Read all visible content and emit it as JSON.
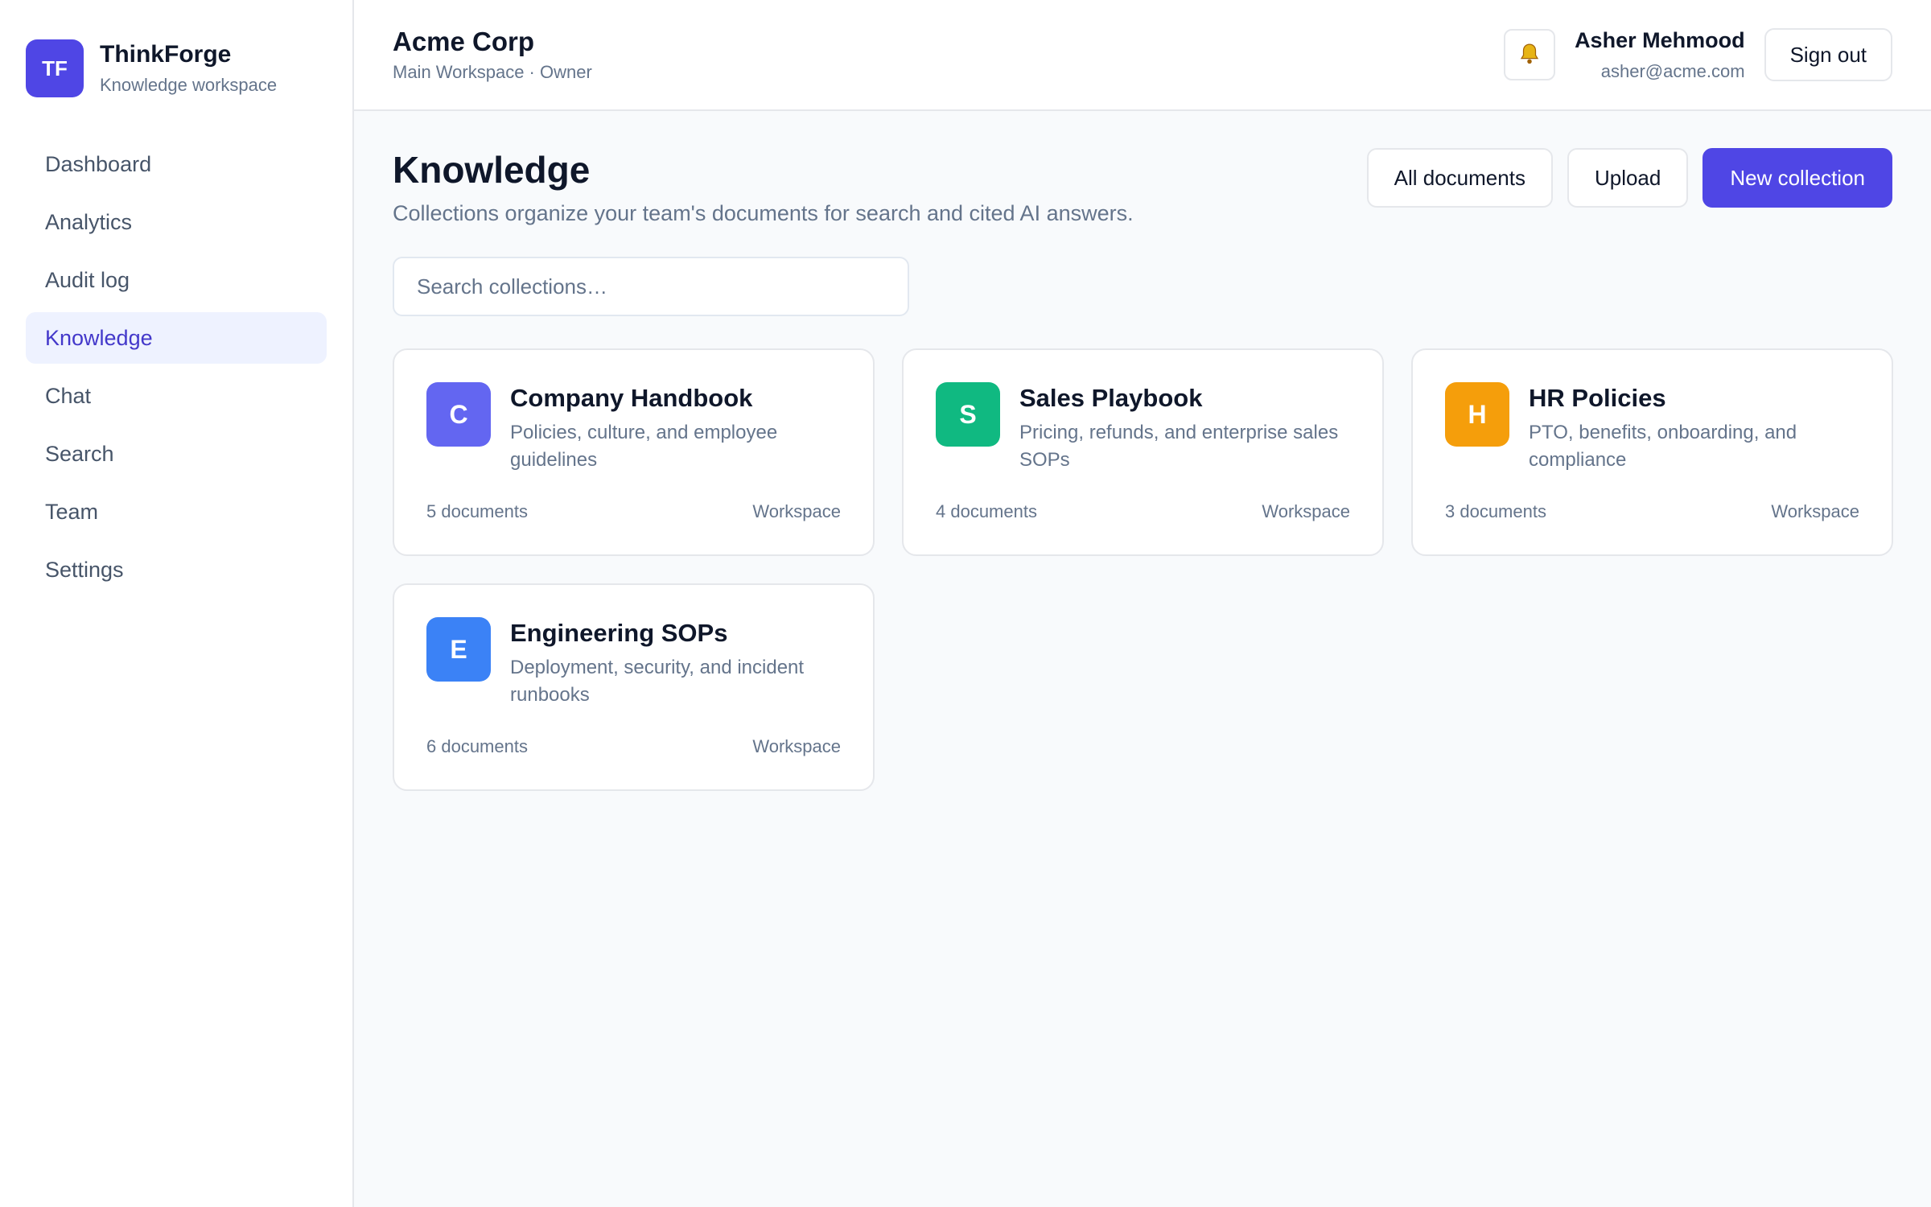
{
  "brand": {
    "initials": "TF",
    "name": "ThinkForge",
    "subtitle": "Knowledge workspace",
    "color": "#4f46e5"
  },
  "sidebar": {
    "items": [
      {
        "label": "Dashboard",
        "active": false
      },
      {
        "label": "Analytics",
        "active": false
      },
      {
        "label": "Audit log",
        "active": false
      },
      {
        "label": "Knowledge",
        "active": true
      },
      {
        "label": "Chat",
        "active": false
      },
      {
        "label": "Search",
        "active": false
      },
      {
        "label": "Team",
        "active": false
      },
      {
        "label": "Settings",
        "active": false
      }
    ]
  },
  "header": {
    "org_name": "Acme Corp",
    "org_sub": "Main Workspace · Owner",
    "bell_icon": "bell-icon",
    "user_name": "Asher Mehmood",
    "user_email": "asher@acme.com",
    "signout_label": "Sign out"
  },
  "page": {
    "title": "Knowledge",
    "subtitle": "Collections organize your team's documents for search and cited AI answers.",
    "actions": {
      "all_documents": "All documents",
      "upload": "Upload",
      "new_collection": "New collection"
    },
    "search_placeholder": "Search collections…"
  },
  "collections": [
    {
      "initial": "C",
      "color": "#6366f1",
      "title": "Company Handbook",
      "description": "Policies, culture, and employee guidelines",
      "count": "5 documents",
      "scope": "Workspace"
    },
    {
      "initial": "S",
      "color": "#10b981",
      "title": "Sales Playbook",
      "description": "Pricing, refunds, and enterprise sales SOPs",
      "count": "4 documents",
      "scope": "Workspace"
    },
    {
      "initial": "H",
      "color": "#f59e0b",
      "title": "HR Policies",
      "description": "PTO, benefits, onboarding, and compliance",
      "count": "3 documents",
      "scope": "Workspace"
    },
    {
      "initial": "E",
      "color": "#3b82f6",
      "title": "Engineering SOPs",
      "description": "Deployment, security, and incident runbooks",
      "count": "6 documents",
      "scope": "Workspace"
    }
  ]
}
